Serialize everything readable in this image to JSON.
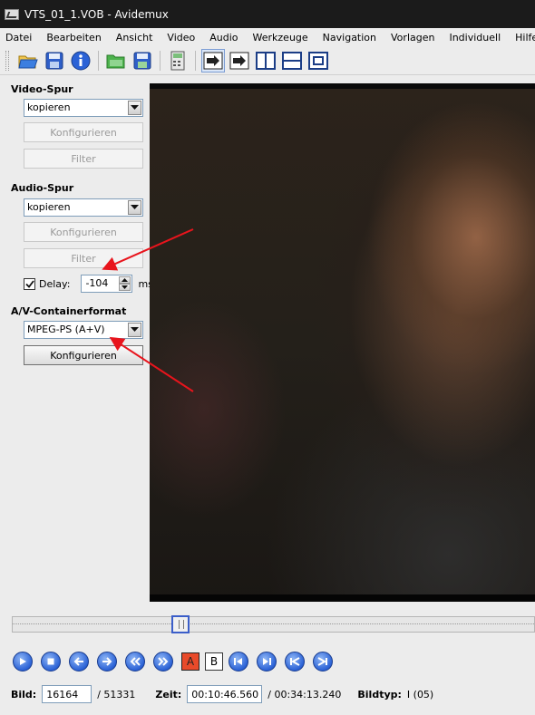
{
  "window": {
    "title": "VTS_01_1.VOB - Avidemux"
  },
  "menu": [
    {
      "label": "Datei"
    },
    {
      "label": "Bearbeiten"
    },
    {
      "label": "Ansicht"
    },
    {
      "label": "Video"
    },
    {
      "label": "Audio"
    },
    {
      "label": "Werkzeuge"
    },
    {
      "label": "Navigation"
    },
    {
      "label": "Vorlagen"
    },
    {
      "label": "Individuell"
    },
    {
      "label": "Hilfe"
    }
  ],
  "toolbar": {
    "icons": [
      "open-folder-icon",
      "save-floppy-icon",
      "info-icon",
      "open-image-icon",
      "save-image-icon",
      "calculator-icon",
      "toggle-view-icon",
      "forward-view-icon",
      "split-vertical-icon",
      "split-horizontal-icon",
      "window-icon"
    ]
  },
  "video_track": {
    "title": "Video-Spur",
    "codec": "kopieren",
    "configure_label": "Konfigurieren",
    "filter_label": "Filter"
  },
  "audio_track": {
    "title": "Audio-Spur",
    "codec": "kopieren",
    "configure_label": "Konfigurieren",
    "filter_label": "Filter",
    "delay_label": "Delay:",
    "delay_value": "-104",
    "delay_unit": "ms",
    "delay_checked": true
  },
  "container": {
    "title": "A/V-Containerformat",
    "format": "MPEG-PS (A+V)",
    "configure_label": "Konfigurieren"
  },
  "timeline": {
    "position_fraction": 0.315
  },
  "marks": {
    "a": "A",
    "b": "B"
  },
  "status": {
    "frame_label": "Bild:",
    "frame_value": "16164",
    "frame_total": "/ 51331",
    "time_label": "Zeit:",
    "time_value": "00:10:46.560",
    "time_total": "/ 00:34:13.240",
    "frametype_label": "Bildtyp:",
    "frametype_value": "I (05)"
  },
  "colors": {
    "arrow": "#e8141c",
    "titlebar": "#1b1b1b",
    "nav_button": "#2b62d6"
  }
}
